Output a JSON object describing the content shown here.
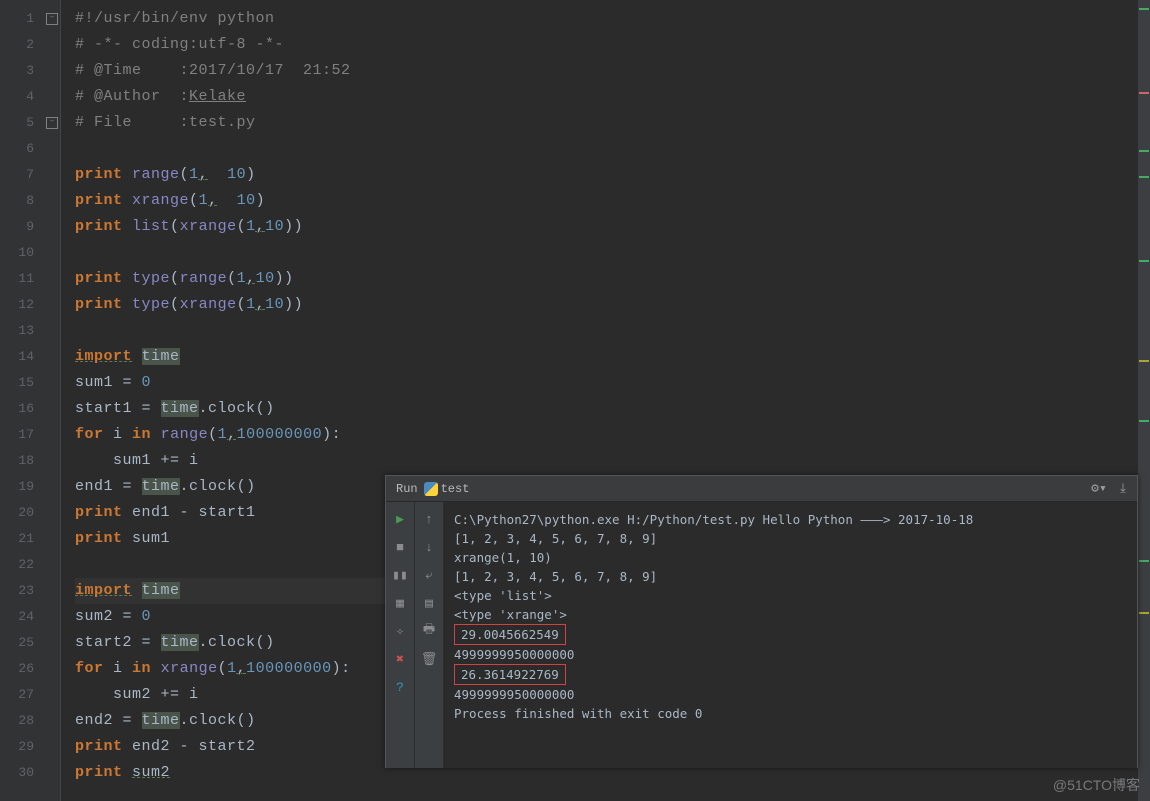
{
  "gutter_lines": 30,
  "code": [
    {
      "t": "cmt",
      "txt": "#!/usr/bin/env python",
      "fold": "–"
    },
    {
      "t": "cmt",
      "txt": "# -*- coding:utf-8 -*-"
    },
    {
      "t": "cmt",
      "txt": "# @Time    :2017/10/17  21:52"
    },
    {
      "t": "auth",
      "txt_prefix": "# @Author  :",
      "author": "Kelake"
    },
    {
      "t": "cmt",
      "txt": "# File     :test.py",
      "fold": "–"
    },
    {
      "t": "blank"
    },
    {
      "t": "pr-range",
      "a": "1",
      "b": "10",
      "fn": "range",
      "trail": ")"
    },
    {
      "t": "pr-range",
      "a": "1",
      "b": "10",
      "fn": "xrange",
      "trail": ")"
    },
    {
      "t": "pr-list",
      "a": "1",
      "b": "10"
    },
    {
      "t": "blank"
    },
    {
      "t": "pr-type",
      "fn": "range",
      "a": "1",
      "b": "10"
    },
    {
      "t": "pr-type",
      "fn": "xrange",
      "a": "1",
      "b": "10"
    },
    {
      "t": "blank"
    },
    {
      "t": "import"
    },
    {
      "t": "assign",
      "lhs": "sum1 = ",
      "rhs": "0"
    },
    {
      "t": "clock",
      "lhs": "start1 = "
    },
    {
      "t": "for",
      "fn": "range",
      "a": "1",
      "b": "100000000"
    },
    {
      "t": "sumadd",
      "name": "sum1"
    },
    {
      "t": "clock",
      "lhs": "end1 = "
    },
    {
      "t": "pr-var",
      "v": "end1 - start1"
    },
    {
      "t": "pr-var",
      "v": "sum1"
    },
    {
      "t": "blank"
    },
    {
      "t": "import",
      "caret": true
    },
    {
      "t": "assign",
      "lhs": "sum2 = ",
      "rhs": "0"
    },
    {
      "t": "clock",
      "lhs": "start2 = "
    },
    {
      "t": "for",
      "fn": "xrange",
      "a": "1",
      "b": "100000000"
    },
    {
      "t": "sumadd",
      "name": "sum2"
    },
    {
      "t": "clock",
      "lhs": "end2 = "
    },
    {
      "t": "pr-var",
      "v": "end2 - start2"
    },
    {
      "t": "pr-var-u",
      "v": "sum2"
    }
  ],
  "run": {
    "label_run": "Run",
    "label_script": "test",
    "console": [
      "C:\\Python27\\python.exe H:/Python/test.py Hello Python ———> 2017-10-18",
      "[1, 2, 3, 4, 5, 6, 7, 8, 9]",
      "xrange(1, 10)",
      "[1, 2, 3, 4, 5, 6, 7, 8, 9]",
      "<type 'list'>",
      "<type 'xrange'>",
      {
        "boxed": "29.0045662549"
      },
      "4999999950000000",
      {
        "boxed": "26.3614922769"
      },
      "4999999950000000",
      "",
      "Process finished with exit code 0"
    ]
  },
  "kw": {
    "print": "print",
    "import": "import",
    "for": "for",
    "in": "in"
  },
  "ident": {
    "time": "time",
    "list": "list",
    "type": "type"
  },
  "watermark": "@51CTO博客"
}
